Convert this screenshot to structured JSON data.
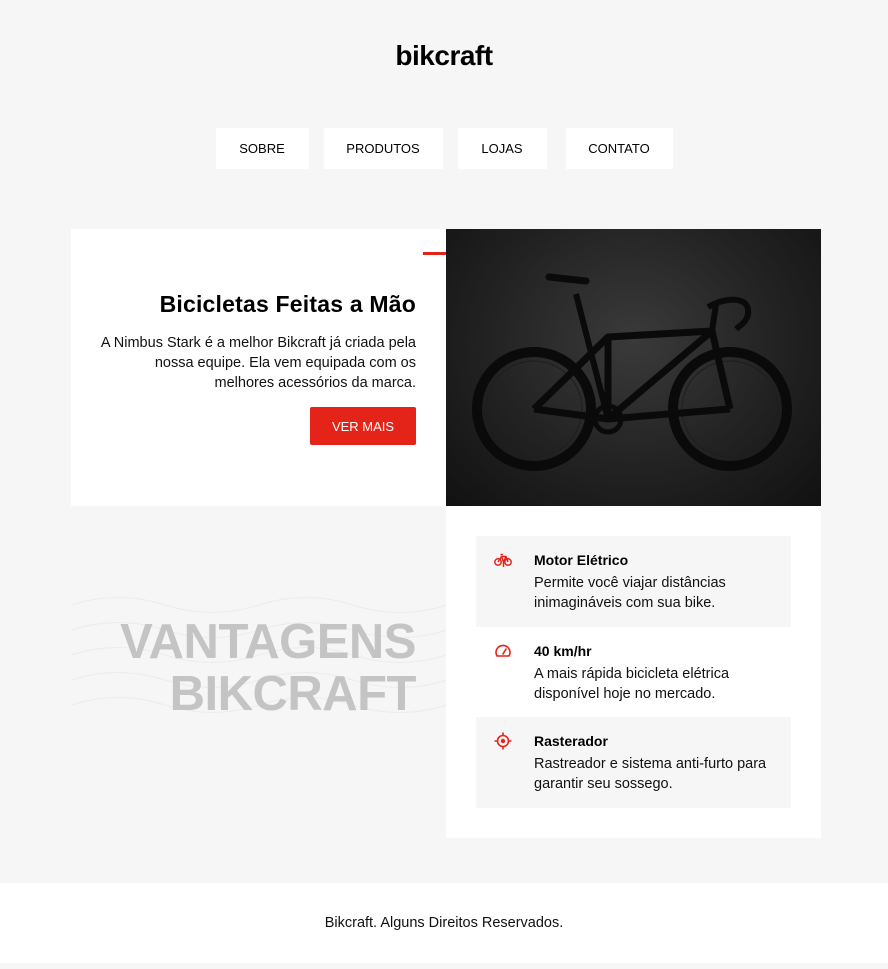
{
  "header": {
    "logo": "bikcraft"
  },
  "nav": {
    "items": [
      "SOBRE",
      "PRODUTOS",
      "LOJAS",
      "CONTATO"
    ]
  },
  "hero": {
    "title": "Bicicletas Feitas a Mão",
    "description": "A Nimbus Stark é a melhor Bikcraft já criada pela nossa equipe. Ela vem equipada com os melhores acessórios da marca.",
    "button_label": "VER MAIS"
  },
  "vantagens": {
    "line1": "VANTAGENS",
    "line2": "BIKCRAFT"
  },
  "features": [
    {
      "icon": "bike-icon",
      "title": "Motor Elétrico",
      "description": "Permite você viajar distâncias inimagináveis com sua bike."
    },
    {
      "icon": "speedometer-icon",
      "title": "40 km/hr",
      "description": "A mais rápida bicicleta elétrica disponível hoje no mercado."
    },
    {
      "icon": "target-icon",
      "title": "Rasterador",
      "description": "Rastreador e sistema anti-furto para garantir seu sossego."
    }
  ],
  "footer": {
    "text": "Bikcraft. Alguns Direitos Reservados."
  },
  "colors": {
    "accent": "#e42418",
    "background": "#f6f6f6",
    "muted_heading": "#c4c4c4"
  }
}
